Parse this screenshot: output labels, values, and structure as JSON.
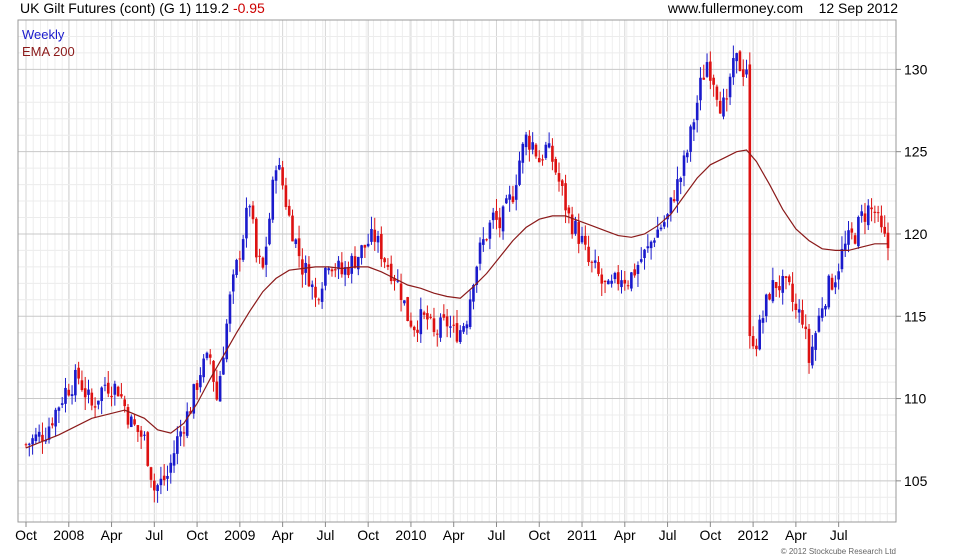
{
  "header": {
    "title": "UK Gilt Futures (cont) (G 1)",
    "price": "119.2",
    "change": "-0.95",
    "site": "www.fullermoney.com",
    "date": "12 Sep 2012"
  },
  "legend": {
    "weekly": "Weekly",
    "ema": "EMA 200",
    "weekly_color": "#1a1acc",
    "ema_color": "#8b1a1a"
  },
  "copyright": "© 2012 Stockcube Research Ltd",
  "chart_data": {
    "type": "line",
    "xlim": [
      0,
      262
    ],
    "ylim": [
      102.5,
      133
    ],
    "y_ticks": [
      105,
      110,
      115,
      120,
      125,
      130
    ],
    "x_ticks": [
      {
        "label": "Oct",
        "week": 0
      },
      {
        "label": "2008",
        "week": 13
      },
      {
        "label": "Apr",
        "week": 26
      },
      {
        "label": "Jul",
        "week": 39
      },
      {
        "label": "Oct",
        "week": 52
      },
      {
        "label": "2009",
        "week": 65
      },
      {
        "label": "Apr",
        "week": 78
      },
      {
        "label": "Jul",
        "week": 91
      },
      {
        "label": "Oct",
        "week": 104
      },
      {
        "label": "2010",
        "week": 117
      },
      {
        "label": "Apr",
        "week": 130
      },
      {
        "label": "Jul",
        "week": 143
      },
      {
        "label": "Oct",
        "week": 156
      },
      {
        "label": "2011",
        "week": 169
      },
      {
        "label": "Apr",
        "week": 182
      },
      {
        "label": "Jul",
        "week": 195
      },
      {
        "label": "Oct",
        "week": 208
      },
      {
        "label": "2012",
        "week": 221
      },
      {
        "label": "Apr",
        "week": 234
      },
      {
        "label": "Jul",
        "week": 247
      }
    ],
    "up_color": "#1a1acc",
    "down_color": "#dd1111",
    "grid": true,
    "legend_position": "top-left",
    "series": [
      {
        "name": "Weekly",
        "points": [
          [
            0,
            107.2
          ],
          [
            6,
            108.0
          ],
          [
            12,
            110.5
          ],
          [
            16,
            111.3
          ],
          [
            20,
            109.5
          ],
          [
            24,
            110.9
          ],
          [
            28,
            110.6
          ],
          [
            32,
            108.5
          ],
          [
            36,
            107.5
          ],
          [
            39,
            104.5
          ],
          [
            43,
            105.3
          ],
          [
            46,
            107.5
          ],
          [
            50,
            109.5
          ],
          [
            53,
            111.7
          ],
          [
            56,
            112.5
          ],
          [
            58,
            110.0
          ],
          [
            62,
            116.0
          ],
          [
            66,
            120.0
          ],
          [
            68,
            122.0
          ],
          [
            70,
            118.5
          ],
          [
            72,
            117.8
          ],
          [
            74,
            121.0
          ],
          [
            76,
            124.5
          ],
          [
            78,
            123.0
          ],
          [
            80,
            121.0
          ],
          [
            82,
            119.5
          ],
          [
            84,
            118.0
          ],
          [
            86,
            117.5
          ],
          [
            88,
            116.0
          ],
          [
            90,
            117.3
          ],
          [
            92,
            118.5
          ],
          [
            96,
            117.6
          ],
          [
            100,
            118.5
          ],
          [
            104,
            119.5
          ],
          [
            106,
            119.8
          ],
          [
            109,
            118.5
          ],
          [
            112,
            117.5
          ],
          [
            114,
            116.5
          ],
          [
            116,
            115.0
          ],
          [
            118,
            114.5
          ],
          [
            120,
            114.8
          ],
          [
            122,
            114.8
          ],
          [
            124,
            113.8
          ],
          [
            126,
            114.3
          ],
          [
            128,
            114.6
          ],
          [
            130,
            114.0
          ],
          [
            132,
            114.2
          ],
          [
            134,
            115.0
          ],
          [
            136,
            117.5
          ],
          [
            138,
            119.0
          ],
          [
            140,
            120.0
          ],
          [
            142,
            121.0
          ],
          [
            144,
            120.5
          ],
          [
            146,
            121.5
          ],
          [
            148,
            122.5
          ],
          [
            150,
            124.5
          ],
          [
            152,
            125.8
          ],
          [
            154,
            125.5
          ],
          [
            156,
            124.5
          ],
          [
            158,
            125.2
          ],
          [
            160,
            124.5
          ],
          [
            163,
            122.5
          ],
          [
            165,
            121.0
          ],
          [
            167,
            120.3
          ],
          [
            169,
            119.5
          ],
          [
            171,
            118.2
          ],
          [
            173,
            117.8
          ],
          [
            175,
            117.0
          ],
          [
            177,
            116.5
          ],
          [
            179,
            117.0
          ],
          [
            181,
            117.5
          ],
          [
            183,
            117.2
          ],
          [
            185,
            117.8
          ],
          [
            187,
            118.5
          ],
          [
            189,
            119.0
          ],
          [
            191,
            120.0
          ],
          [
            193,
            120.5
          ],
          [
            195,
            121.0
          ],
          [
            197,
            122.5
          ],
          [
            199,
            123.5
          ],
          [
            201,
            125.0
          ],
          [
            203,
            127.0
          ],
          [
            205,
            129.0
          ],
          [
            207,
            130.5
          ],
          [
            209,
            129.5
          ],
          [
            211,
            128.0
          ],
          [
            213,
            127.5
          ],
          [
            214,
            129.5
          ],
          [
            216,
            130.5
          ],
          [
            218,
            130.0
          ],
          [
            219,
            130.2
          ],
          [
            220,
            114.0
          ],
          [
            222,
            113.5
          ],
          [
            224,
            115.0
          ],
          [
            226,
            116.5
          ],
          [
            228,
            117.0
          ],
          [
            230,
            116.8
          ],
          [
            232,
            116.5
          ],
          [
            234,
            115.2
          ],
          [
            236,
            115.0
          ],
          [
            238,
            112.3
          ],
          [
            240,
            114.0
          ],
          [
            242,
            115.8
          ],
          [
            244,
            116.8
          ],
          [
            246,
            117.5
          ],
          [
            248,
            118.8
          ],
          [
            250,
            119.6
          ],
          [
            252,
            120.0
          ],
          [
            254,
            121.0
          ],
          [
            256,
            121.5
          ],
          [
            258,
            121.3
          ],
          [
            260,
            120.0
          ],
          [
            262,
            119.2
          ]
        ]
      },
      {
        "name": "EMA 200",
        "points": [
          [
            0,
            107.0
          ],
          [
            10,
            107.8
          ],
          [
            20,
            108.8
          ],
          [
            30,
            109.3
          ],
          [
            36,
            108.8
          ],
          [
            40,
            108.1
          ],
          [
            44,
            107.9
          ],
          [
            48,
            108.5
          ],
          [
            52,
            109.7
          ],
          [
            56,
            111.2
          ],
          [
            60,
            112.6
          ],
          [
            64,
            114.0
          ],
          [
            68,
            115.3
          ],
          [
            72,
            116.5
          ],
          [
            76,
            117.3
          ],
          [
            80,
            117.8
          ],
          [
            84,
            117.9
          ],
          [
            88,
            118.0
          ],
          [
            92,
            118.0
          ],
          [
            96,
            117.9
          ],
          [
            100,
            118.0
          ],
          [
            104,
            118.0
          ],
          [
            108,
            117.7
          ],
          [
            112,
            117.3
          ],
          [
            116,
            116.9
          ],
          [
            120,
            116.7
          ],
          [
            124,
            116.4
          ],
          [
            128,
            116.2
          ],
          [
            132,
            116.1
          ],
          [
            136,
            116.8
          ],
          [
            140,
            117.6
          ],
          [
            144,
            118.6
          ],
          [
            148,
            119.6
          ],
          [
            152,
            120.4
          ],
          [
            156,
            120.9
          ],
          [
            160,
            121.1
          ],
          [
            164,
            121.1
          ],
          [
            168,
            120.8
          ],
          [
            172,
            120.5
          ],
          [
            176,
            120.2
          ],
          [
            180,
            119.9
          ],
          [
            184,
            119.8
          ],
          [
            188,
            120.0
          ],
          [
            192,
            120.5
          ],
          [
            196,
            121.2
          ],
          [
            200,
            122.3
          ],
          [
            204,
            123.4
          ],
          [
            208,
            124.2
          ],
          [
            212,
            124.6
          ],
          [
            216,
            125.0
          ],
          [
            219,
            125.1
          ],
          [
            222,
            124.4
          ],
          [
            226,
            123.0
          ],
          [
            230,
            121.5
          ],
          [
            234,
            120.3
          ],
          [
            238,
            119.6
          ],
          [
            242,
            119.1
          ],
          [
            246,
            119.0
          ],
          [
            250,
            119.0
          ],
          [
            254,
            119.2
          ],
          [
            258,
            119.4
          ],
          [
            262,
            119.4
          ]
        ]
      }
    ]
  }
}
